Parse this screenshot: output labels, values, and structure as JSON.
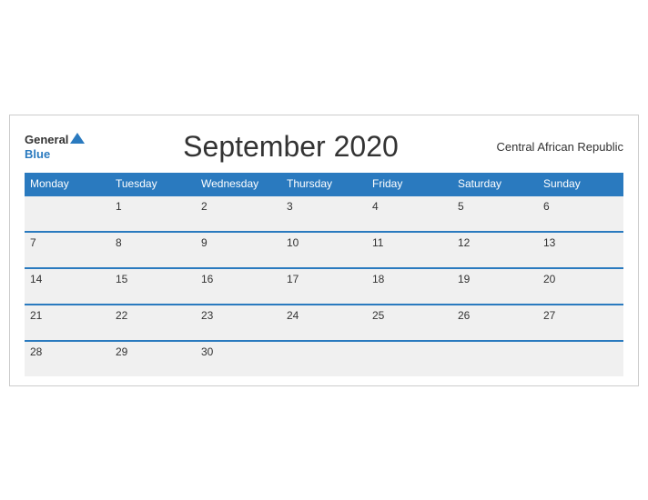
{
  "header": {
    "logo_general": "General",
    "logo_blue": "Blue",
    "month_title": "September 2020",
    "country": "Central African Republic"
  },
  "days_of_week": [
    "Monday",
    "Tuesday",
    "Wednesday",
    "Thursday",
    "Friday",
    "Saturday",
    "Sunday"
  ],
  "weeks": [
    [
      "",
      "1",
      "2",
      "3",
      "4",
      "5",
      "6"
    ],
    [
      "7",
      "8",
      "9",
      "10",
      "11",
      "12",
      "13"
    ],
    [
      "14",
      "15",
      "16",
      "17",
      "18",
      "19",
      "20"
    ],
    [
      "21",
      "22",
      "23",
      "24",
      "25",
      "26",
      "27"
    ],
    [
      "28",
      "29",
      "30",
      "",
      "",
      "",
      ""
    ]
  ]
}
